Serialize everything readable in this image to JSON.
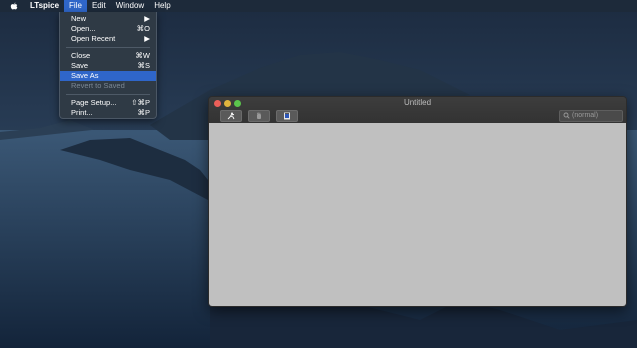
{
  "menubar": {
    "app_name": "LTspice",
    "items": [
      "File",
      "Edit",
      "Window",
      "Help"
    ]
  },
  "file_menu": {
    "items": [
      {
        "label": "New",
        "shortcut": "▶"
      },
      {
        "label": "Open...",
        "shortcut": "⌘O"
      },
      {
        "label": "Open Recent",
        "shortcut": "▶"
      },
      {
        "label": "Close",
        "shortcut": "⌘W"
      },
      {
        "label": "Save",
        "shortcut": "⌘S"
      },
      {
        "label": "Save As",
        "shortcut": ""
      },
      {
        "label": "Revert to Saved",
        "shortcut": ""
      },
      {
        "label": "Page Setup...",
        "shortcut": "⇧⌘P"
      },
      {
        "label": "Print...",
        "shortcut": "⌘P"
      }
    ]
  },
  "window": {
    "title": "Untitled",
    "search_placeholder": "(normal)"
  },
  "colors": {
    "menu_highlight": "#2f66c9",
    "canvas_gray": "#c0c0c0"
  }
}
